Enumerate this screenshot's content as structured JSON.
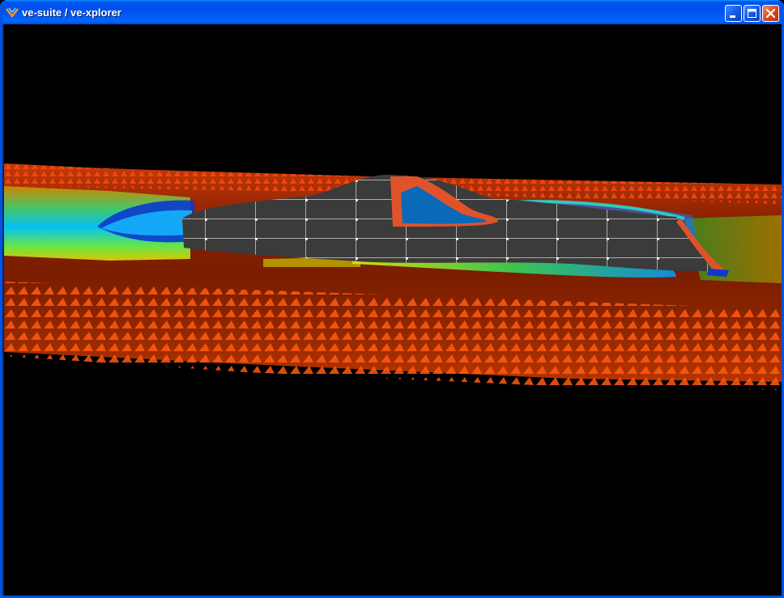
{
  "window": {
    "title": "ve-suite / ve-xplorer",
    "icon": "ve-suite-app-icon",
    "controls": [
      {
        "name": "minimize-button",
        "icon": "minimize-icon"
      },
      {
        "name": "maximize-button",
        "icon": "maximize-icon"
      },
      {
        "name": "close-button",
        "icon": "close-icon"
      }
    ],
    "colors": {
      "titlebar": "#0058ee",
      "close": "#d8471e",
      "viewport_background": "#000000"
    }
  },
  "scene": {
    "description_icon": "3d-flow-visualization",
    "colors": {
      "high": "#ff4000",
      "mid_high": "#a02800",
      "mid": "#ffcc00",
      "mid_low": "#80ff20",
      "low": "#00c0ff",
      "lowest": "#0030c0",
      "surface": "#3a3a3a",
      "surface_grid": "#cfcfcf",
      "patch": "#e05028",
      "patch_inner": "#0a6ab8"
    }
  }
}
